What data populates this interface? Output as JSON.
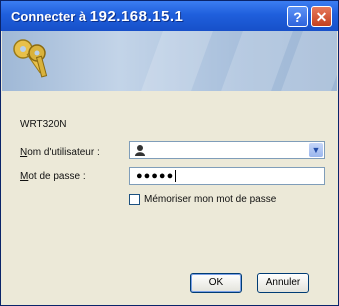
{
  "window": {
    "title_prefix": "Connecter à ",
    "title_host": "192.168.15.1",
    "help_label": "?",
    "close_label": "✕"
  },
  "icons": {
    "banner": "keys-icon",
    "user": "user-icon",
    "dropdown": "chevron-down-icon"
  },
  "form": {
    "device_name": "WRT320N",
    "username_label_access": "N",
    "username_label_rest": "om d'utilisateur :",
    "username_value": "",
    "password_label_access": "M",
    "password_label_rest": "ot de passe :",
    "password_value": "●●●●●",
    "remember_label": "Mémoriser mon mot de passe",
    "remember_checked": false
  },
  "buttons": {
    "ok": "OK",
    "cancel": "Annuler"
  },
  "colors": {
    "titlebar": "#1f5fdc",
    "dialog_bg": "#ece9d8",
    "close_button": "#c4401e"
  }
}
